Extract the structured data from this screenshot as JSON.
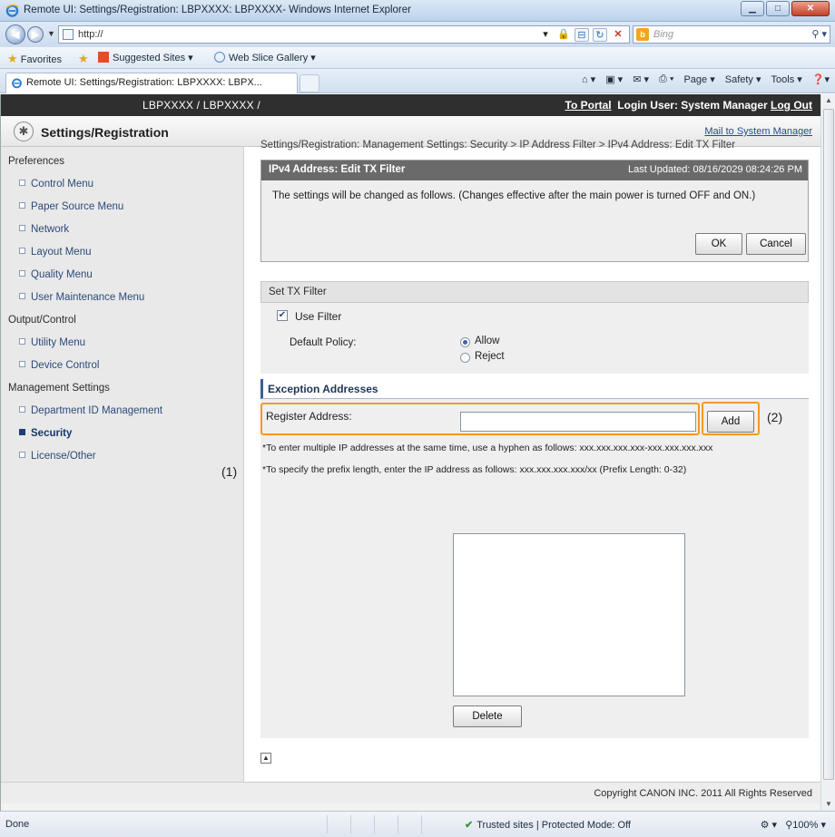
{
  "browser": {
    "window_title": "Remote UI: Settings/Registration: LBPXXXX: LBPXXXX- Windows Internet Explorer",
    "url": "http://",
    "search_placeholder": "Bing",
    "favorites_label": "Favorites",
    "suggested_sites": "Suggested Sites ▾",
    "web_slice_gallery": "Web Slice Gallery ▾",
    "tab_title": "Remote UI: Settings/Registration: LBPXXXX: LBPX...",
    "commands": [
      "Page ▾",
      "Safety ▾",
      "Tools ▾"
    ],
    "status_done": "Done",
    "security_zone": "Trusted sites | Protected Mode: Off",
    "zoom": "100%"
  },
  "page": {
    "device_name": "LBPXXXX / LBPXXXX /",
    "to_portal": "To Portal",
    "login_user": "Login User: System Manager",
    "log_out": "Log Out",
    "title": "Settings/Registration",
    "mail_link": "Mail to System Manager",
    "breadcrumb": "Settings/Registration: Management Settings: Security > IP Address Filter > IPv4 Address: Edit TX Filter",
    "copyright": "Copyright CANON INC. 2011 All Rights Reserved"
  },
  "sidebar": {
    "groups": [
      {
        "label": "Preferences",
        "items": [
          "Control Menu",
          "Paper Source Menu",
          "Network",
          "Layout Menu",
          "Quality Menu",
          "User Maintenance Menu"
        ]
      },
      {
        "label": "Output/Control",
        "items": [
          "Utility Menu",
          "Device Control"
        ]
      },
      {
        "label": "Management Settings",
        "items": [
          "Department ID Management",
          "Security",
          "License/Other"
        ]
      }
    ],
    "active_item": "Security"
  },
  "confirm": {
    "title": "IPv4 Address: Edit TX Filter",
    "last_updated": "Last Updated: 08/16/2029 08:24:26 PM",
    "message": "The settings will be changed as follows. (Changes effective after the main power is turned OFF and ON.)",
    "ok": "OK",
    "cancel": "Cancel"
  },
  "tx_filter": {
    "heading": "Set TX Filter",
    "use_filter_label": "Use Filter",
    "use_filter_checked": true,
    "default_policy_label": "Default Policy:",
    "options": [
      "Allow",
      "Reject"
    ],
    "selected": "Allow"
  },
  "exceptions": {
    "heading": "Exception Addresses",
    "register_label": "Register Address:",
    "register_value": "",
    "add": "Add",
    "note1": "*To enter multiple IP addresses at the same time, use a hyphen as follows: xxx.xxx.xxx.xxx-xxx.xxx.xxx.xxx",
    "note2": "*To specify the prefix length, enter the IP address as follows: xxx.xxx.xxx.xxx/xx (Prefix Length: 0-32)",
    "delete": "Delete",
    "callout_1": "(1)",
    "callout_2": "(2)"
  },
  "colors": {
    "callout": "#f39a21",
    "top_band": "#2f2f2f",
    "confirm_bar": "#6a6a6a",
    "link": "#1f4c8f"
  }
}
